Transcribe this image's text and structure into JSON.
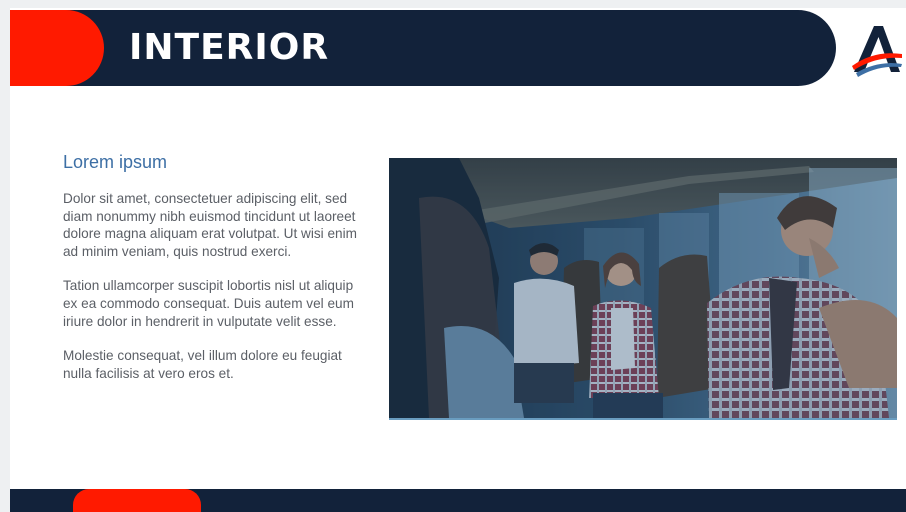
{
  "header": {
    "title": "INTERIOR",
    "logo_icon": "brand-logo-a-icon",
    "bar_color": "#12223a",
    "accent_color": "#ff1a00"
  },
  "content": {
    "subtitle": "Lorem ipsum",
    "paragraphs": [
      "Dolor sit amet, consectetuer adipiscing elit, sed diam nonummy nibh euismod tincidunt ut laoreet dolore magna aliquam erat volutpat. Ut wisi enim ad minim veniam, quis nostrud exerci.",
      "Tation ullamcorper suscipit lobortis nisl ut aliquip ex ea commodo consequat. Duis autem vel eum iriure dolor in hendrerit in vulputate velit esse.",
      "Molestie consequat, vel illum dolore eu feugiat nulla facilisis at vero eros et."
    ],
    "subtitle_color": "#3d6fa5"
  },
  "image": {
    "icon": "bus-interior-photo"
  }
}
